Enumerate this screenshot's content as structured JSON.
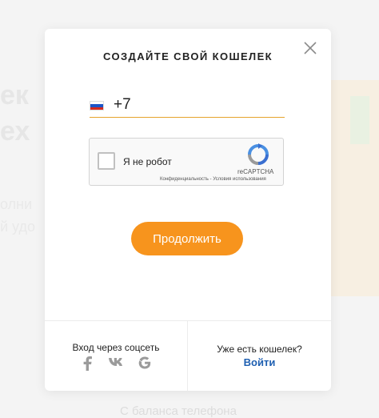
{
  "background": {
    "heading_line1": "ек",
    "heading_line2": "ех",
    "text_line1": "олни",
    "text_line2": "й удо",
    "bottom_text": "С баланса телефона"
  },
  "modal": {
    "title": "СОЗДАЙТЕ СВОЙ КОШЕЛЕК",
    "phone": {
      "country_flag": "russia-flag",
      "value": "+7",
      "underline_color": "#e6a32c"
    },
    "captcha": {
      "checkbox_label": "Я не робот",
      "brand": "reCAPTCHA",
      "links": "Конфиденциальность - Условия использования"
    },
    "continue_label": "Продолжить",
    "continue_color": "#f7941d",
    "social": {
      "title": "Вход через соцсеть",
      "icons": [
        "facebook-icon",
        "vk-icon",
        "google-icon"
      ]
    },
    "existing": {
      "title": "Уже есть кошелек?",
      "login_label": "Войти",
      "link_color": "#1e5fb1"
    }
  }
}
